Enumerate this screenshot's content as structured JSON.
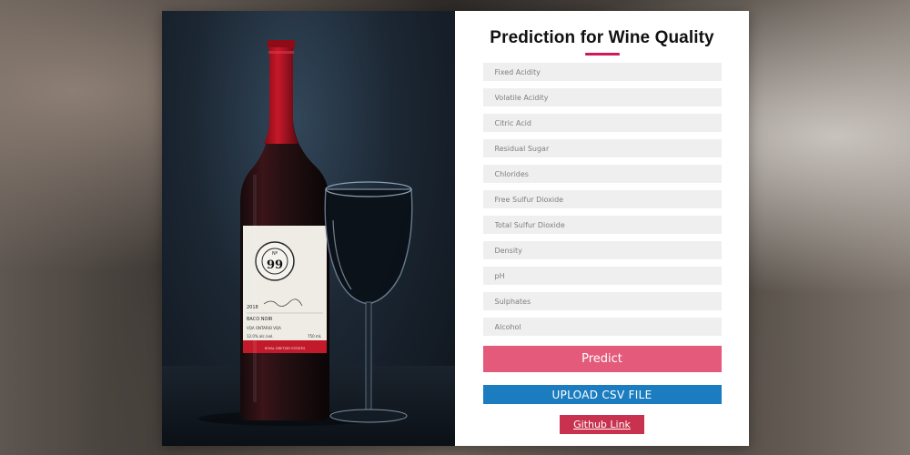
{
  "form": {
    "title": "Prediction for Wine Quality",
    "fields": [
      {
        "placeholder": "Fixed Acidity"
      },
      {
        "placeholder": "Volatile Acidity"
      },
      {
        "placeholder": "Citric Acid"
      },
      {
        "placeholder": "Residual Sugar"
      },
      {
        "placeholder": "Chlorides"
      },
      {
        "placeholder": "Free Sulfur Dioxide"
      },
      {
        "placeholder": "Total Sulfur Dioxide"
      },
      {
        "placeholder": "Density"
      },
      {
        "placeholder": "pH"
      },
      {
        "placeholder": "Sulphates"
      },
      {
        "placeholder": "Alcohol"
      }
    ],
    "predict_label": "Predict",
    "upload_label": "UPLOAD CSV FILE",
    "github_label": "Github Link"
  },
  "photo": {
    "label_number": "99",
    "label_no": "Nº",
    "label_year": "2018",
    "label_variety": "BACO NOIR",
    "label_region": "VQA ONTARIO VQA",
    "label_abv": "12.0% alc./vol.",
    "label_volume": "750 mL",
    "label_footer": "ROYAL DRETZKY ESTATES"
  },
  "colors": {
    "accent": "#d2185c",
    "predict": "#e45a7a",
    "upload": "#1b7dc0",
    "github": "#c9324e"
  }
}
